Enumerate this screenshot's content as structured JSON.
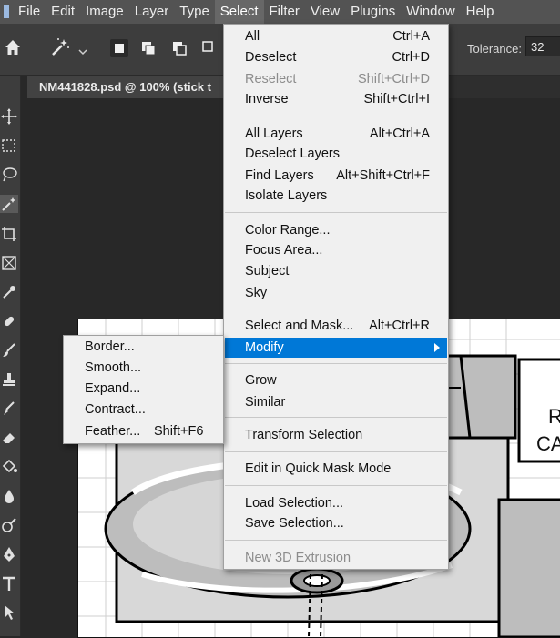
{
  "menubar": {
    "items": [
      "File",
      "Edit",
      "Image",
      "Layer",
      "Type",
      "Select",
      "Filter",
      "View",
      "Plugins",
      "Window",
      "Help"
    ],
    "active": "Select"
  },
  "options": {
    "tolerance_label": "Tolerance:",
    "tolerance_value": "32"
  },
  "document": {
    "tab_title": "NM441828.psd @ 100% (stick t"
  },
  "select_menu": {
    "items": [
      {
        "label": "All",
        "shortcut": "Ctrl+A",
        "enabled": true
      },
      {
        "label": "Deselect",
        "shortcut": "Ctrl+D",
        "enabled": true
      },
      {
        "label": "Reselect",
        "shortcut": "Shift+Ctrl+D",
        "enabled": false
      },
      {
        "label": "Inverse",
        "shortcut": "Shift+Ctrl+I",
        "enabled": true
      },
      {
        "label": "All Layers",
        "shortcut": "Alt+Ctrl+A",
        "enabled": true
      },
      {
        "label": "Deselect Layers",
        "shortcut": "",
        "enabled": true
      },
      {
        "label": "Find Layers",
        "shortcut": "Alt+Shift+Ctrl+F",
        "enabled": true
      },
      {
        "label": "Isolate Layers",
        "shortcut": "",
        "enabled": true
      },
      {
        "label": "Color Range...",
        "shortcut": "",
        "enabled": true
      },
      {
        "label": "Focus Area...",
        "shortcut": "",
        "enabled": true
      },
      {
        "label": "Subject",
        "shortcut": "",
        "enabled": true
      },
      {
        "label": "Sky",
        "shortcut": "",
        "enabled": true
      },
      {
        "label": "Select and Mask...",
        "shortcut": "Alt+Ctrl+R",
        "enabled": true
      },
      {
        "label": "Modify",
        "shortcut": "",
        "enabled": true,
        "highlighted": true,
        "submenu": true
      },
      {
        "label": "Grow",
        "shortcut": "",
        "enabled": true
      },
      {
        "label": "Similar",
        "shortcut": "",
        "enabled": true
      },
      {
        "label": "Transform Selection",
        "shortcut": "",
        "enabled": true
      },
      {
        "label": "Edit in Quick Mask Mode",
        "shortcut": "",
        "enabled": true
      },
      {
        "label": "Load Selection...",
        "shortcut": "",
        "enabled": true
      },
      {
        "label": "Save Selection...",
        "shortcut": "",
        "enabled": true
      },
      {
        "label": "New 3D Extrusion",
        "shortcut": "",
        "enabled": false
      }
    ]
  },
  "modify_submenu": {
    "items": [
      {
        "label": "Border...",
        "shortcut": ""
      },
      {
        "label": "Smooth...",
        "shortcut": ""
      },
      {
        "label": "Expand...",
        "shortcut": ""
      },
      {
        "label": "Contract...",
        "shortcut": ""
      },
      {
        "label": "Feather...",
        "shortcut": "Shift+F6"
      }
    ]
  },
  "canvas_text": {
    "line1": "R",
    "line2": "CA"
  },
  "colors": {
    "menubar_bg": "#535353",
    "panel_bg": "#3d3d3d",
    "menu_bg": "#f0f0f0",
    "highlight": "#0078d7",
    "disabled": "#8c8c8c"
  }
}
